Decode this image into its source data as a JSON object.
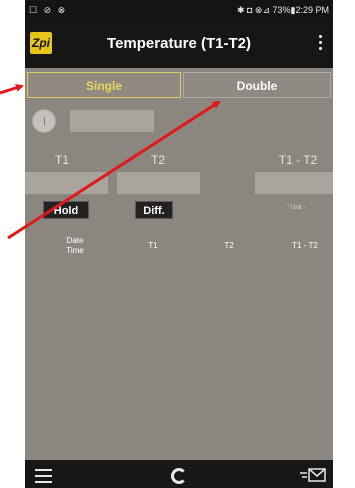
{
  "status": {
    "left_icons": "☐ ⊘ ⊗",
    "right_text": "✱ ◘ ⊗⊿ 73%▮2:29 PM"
  },
  "appbar": {
    "logo_text": "Zpi",
    "title": "Temperature (T1-T2)"
  },
  "tabs": [
    {
      "label": "Single",
      "selected": true
    },
    {
      "label": "Double",
      "selected": false
    }
  ],
  "readings": {
    "t1_label": "T1",
    "t2_label": "T2",
    "diff_label": "T1 - T2",
    "t1_value": "",
    "t2_value": "",
    "diff_value": "",
    "single_value": ""
  },
  "buttons": {
    "hold": "Hold",
    "diff": "Diff."
  },
  "unit_text": "° Unit -",
  "table": {
    "headers": [
      "Date\nTime",
      "T1",
      "T2",
      "T1 - T2"
    ],
    "rows": []
  },
  "colors": {
    "accent": "#e8d85a",
    "arrow": "#e01a1a",
    "bar": "#161616"
  },
  "icons": [
    "list-icon",
    "refresh-icon",
    "send-icon",
    "menu-dots-icon"
  ]
}
